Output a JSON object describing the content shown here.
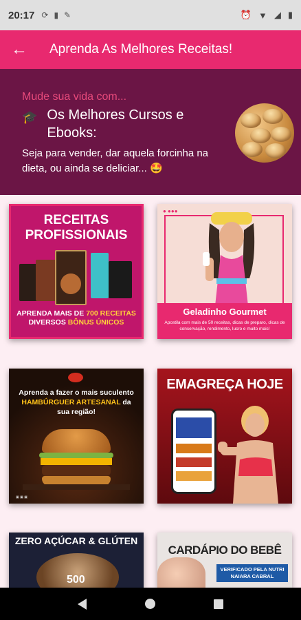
{
  "status_bar": {
    "time": "20:17",
    "battery_icon": "battery-icon",
    "wifi_icon": "wifi-icon",
    "alarm_icon": "alarm-icon"
  },
  "app_bar": {
    "title": "Aprenda As Melhores Receitas!",
    "back_icon": "arrow-back-icon"
  },
  "hero": {
    "kicker": "Mude sua vida com...",
    "headline": "Os Melhores Cursos e Ebooks:",
    "subtitle": "Seja para vender, dar aquela forcinha na dieta, ou ainda se deliciar... 🤩",
    "cap_icon": "graduation-cap-icon"
  },
  "cards": [
    {
      "title": "RECEITAS PROFISSIONAIS",
      "footer_prefix": "APRENDA MAIS DE ",
      "footer_highlight": "700 RECEITAS",
      "footer_mid": " DIVERSOS ",
      "footer_bonus": "BÔNUS ÚNICOS"
    },
    {
      "title": "Geladinho Gourmet",
      "description": "Apostila com mais de 50 receitas, dicas de preparo, dicas de conservação, rendimento, lucro e muito mais!"
    },
    {
      "title_prefix": "Aprenda a fazer o mais suculento ",
      "title_highlight": "HAMBÚRGUER ARTESANAL",
      "title_suffix": " da sua região!"
    },
    {
      "title": "EMAGREÇA HOJE"
    },
    {
      "title": "ZERO AÇÚCAR & GLÚTEN",
      "number": "500"
    },
    {
      "title": "CARDÁPIO DO BEBÊ",
      "badge": "VERIFICADO PELA NUTRI NAIARA CABRAL"
    }
  ],
  "colors": {
    "primary": "#e8296f",
    "hero_bg": "#6b1545",
    "page_bg": "#fdeef3"
  }
}
